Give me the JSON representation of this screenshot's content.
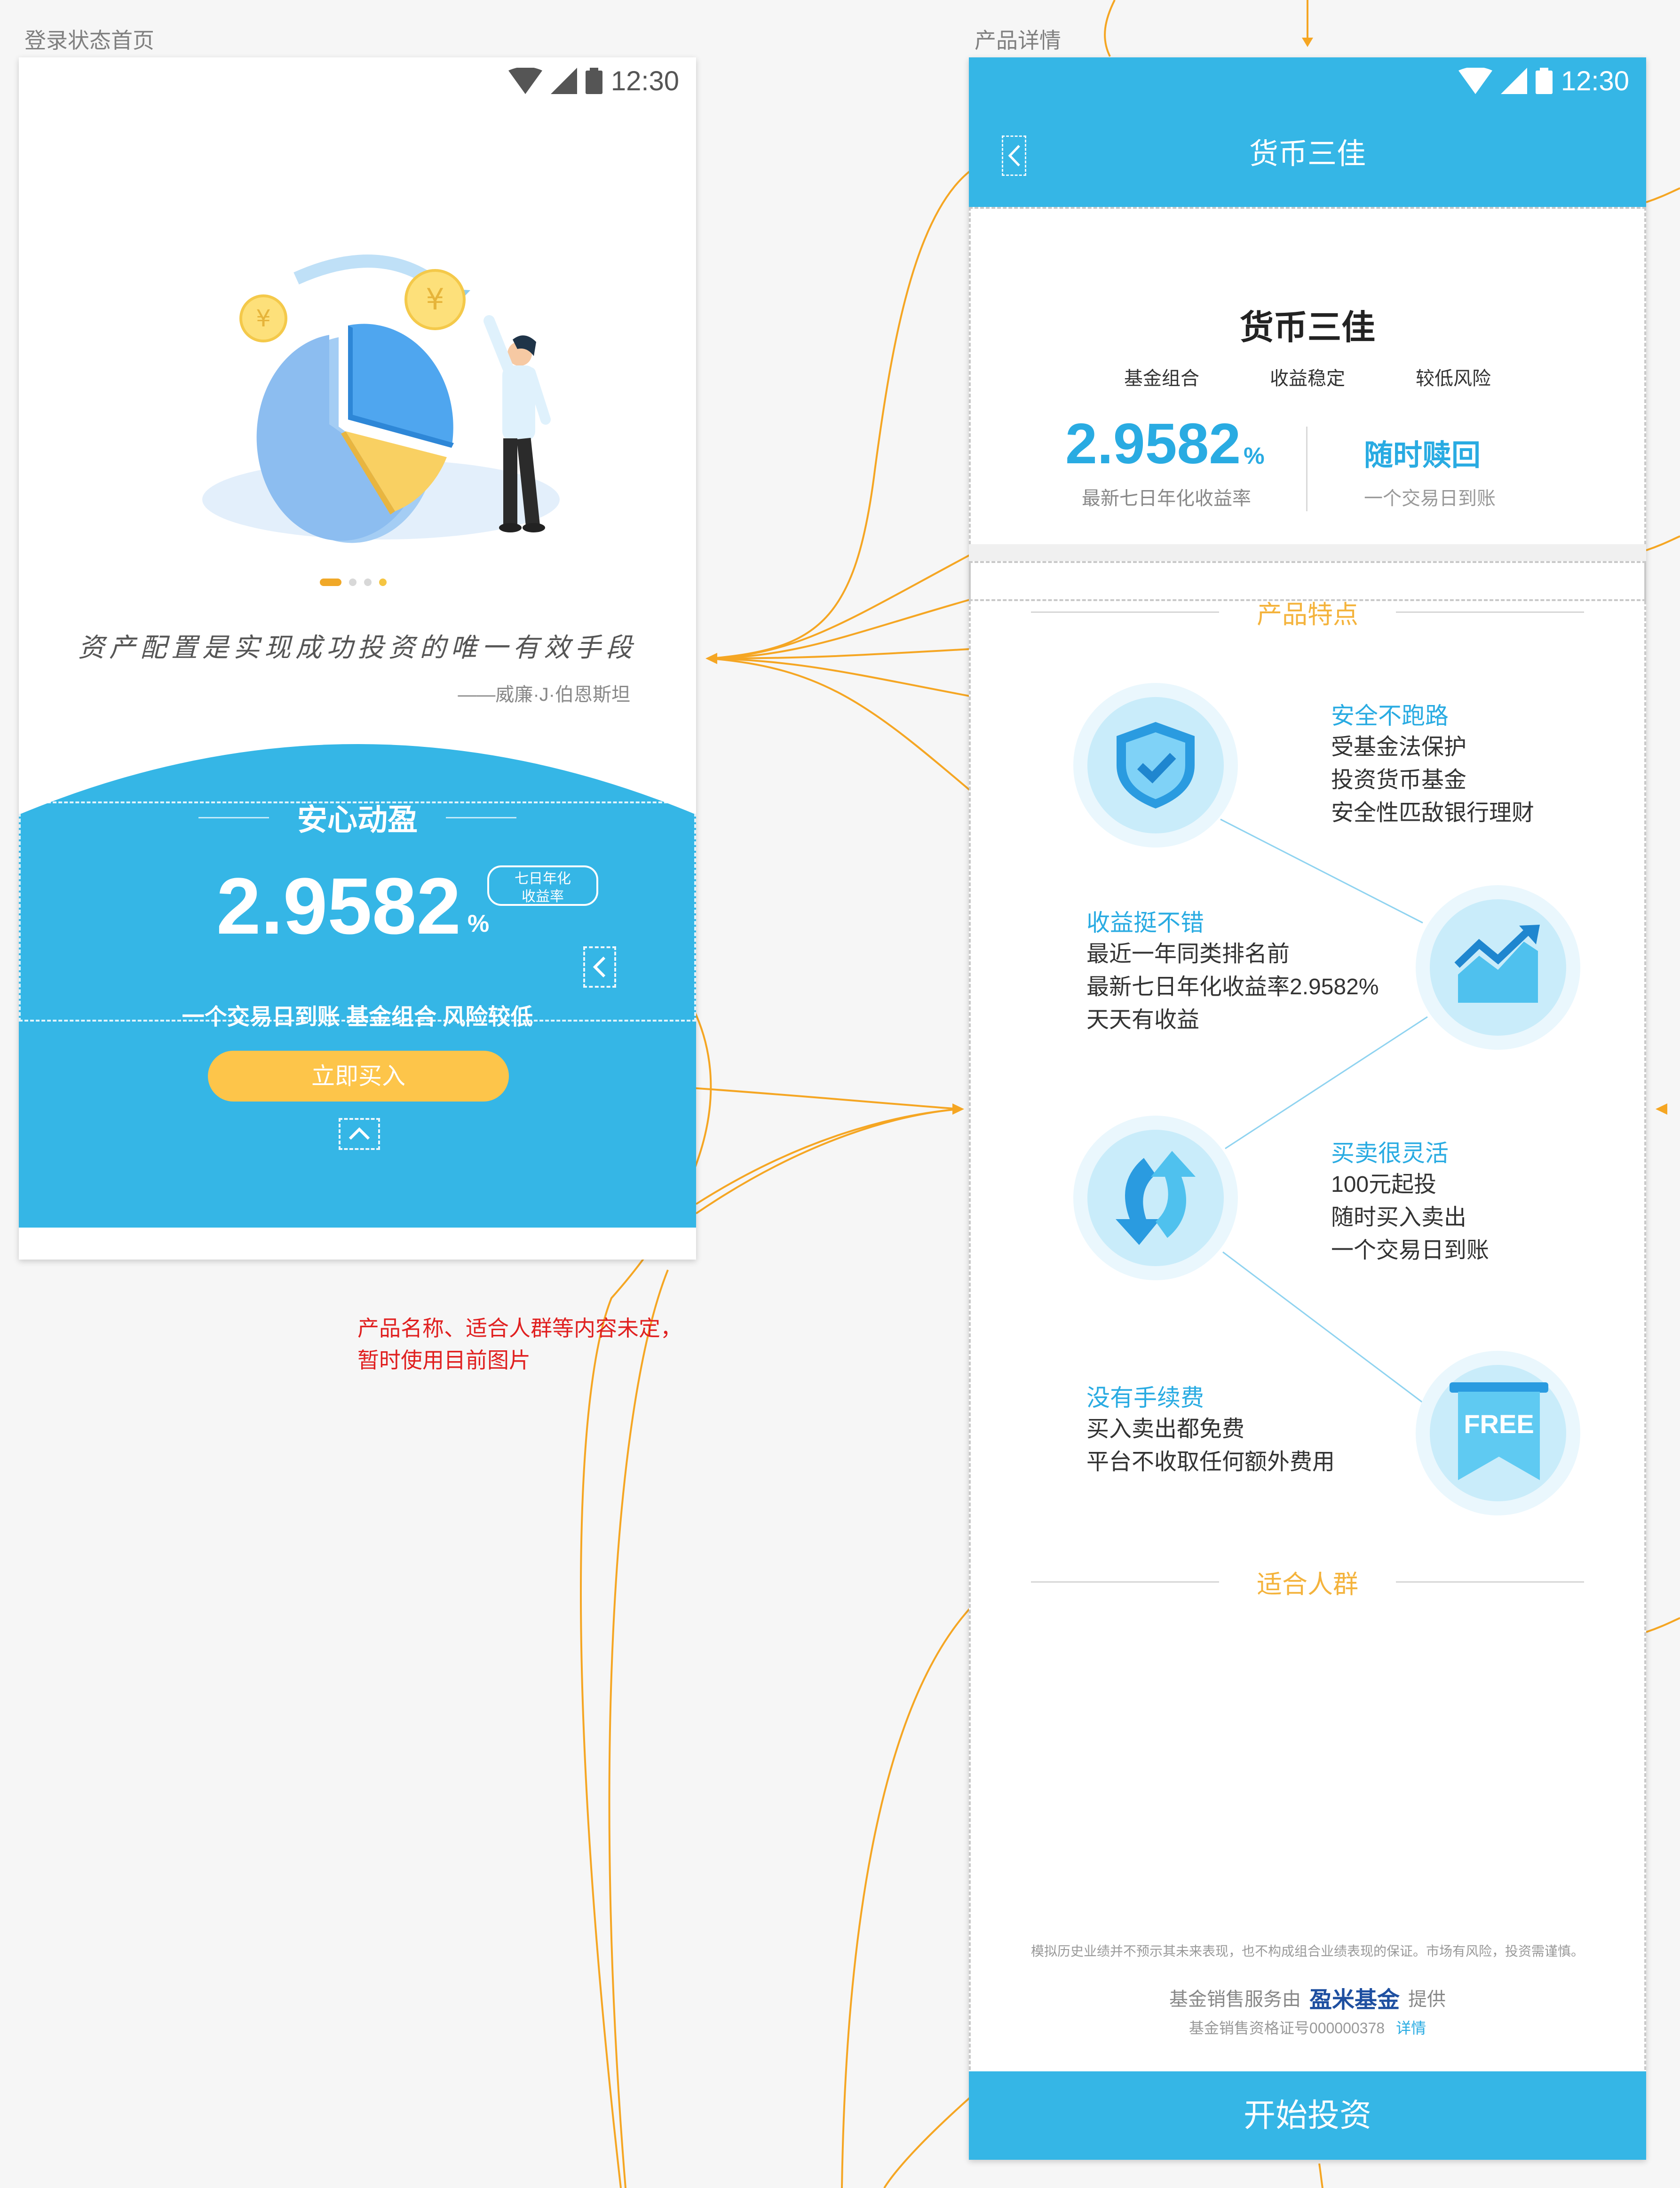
{
  "boards": {
    "left_label": "登录状态首页",
    "right_label": "产品详情"
  },
  "status": {
    "time": "12:30"
  },
  "home": {
    "pager_dots": [
      "active",
      "inactive",
      "inactive",
      "accent"
    ],
    "quote": "资产配置是实现成功投资的唯一有效手段",
    "quote_author": "——威廉·J·伯恩斯坦",
    "product_title": "安心动盈",
    "rate_value": "2.9582",
    "rate_unit": "%",
    "rate_tag_line1": "七日年化",
    "rate_tag_line2": "收益率",
    "tags_line": "一个交易日到账 基金组合 风险较低",
    "buy_button": "立即买入",
    "colors": {
      "brand_blue": "#35b6e6",
      "buy_yellow": "#fdc54a",
      "dot_active": "#f0a828"
    }
  },
  "annotation": {
    "note_line1": "产品名称、适合人群等内容未定，",
    "note_line2": "暂时使用目前图片",
    "note_color": "#e02020",
    "arrow_color": "#f5a623"
  },
  "detail": {
    "nav_title": "货币三佳",
    "header_title": "货币三佳",
    "tags": [
      "基金组合",
      "收益稳定",
      "较低风险"
    ],
    "rate_value": "2.9582",
    "rate_unit": "%",
    "rate_caption": "最新七日年化收益率",
    "redeem_title": "随时赎回",
    "redeem_caption": "一个交易日到账",
    "section_features": "产品特点",
    "features": [
      {
        "icon": "shield-check-icon",
        "title": "安全不跑路",
        "lines": [
          "受基金法保护",
          "投资货币基金",
          "安全性匹敌银行理财"
        ]
      },
      {
        "icon": "trend-chart-icon",
        "title": "收益挺不错",
        "lines": [
          "最近一年同类排名前",
          "最新七日年化收益率2.9582%",
          "天天有收益"
        ]
      },
      {
        "icon": "refresh-arrows-icon",
        "title": "买卖很灵活",
        "lines": [
          "100元起投",
          "随时买入卖出",
          "一个交易日到账"
        ]
      },
      {
        "icon": "free-badge-icon",
        "title": "没有手续费",
        "lines": [
          "买入卖出都免费",
          "平台不收取任何额外费用"
        ]
      }
    ],
    "free_badge_text": "FREE",
    "section_audience": "适合人群",
    "disclaimer": "模拟历史业绩并不预示其未来表现，也不构成组合业绩表现的保证。市场有风险，投资需谨慎。",
    "provider_prefix": "基金销售服务由",
    "provider_brand": "盈米基金",
    "provider_suffix": "提供",
    "license_text": "基金销售资格证号000000378",
    "license_link": "详情",
    "cta_button": "开始投资"
  }
}
